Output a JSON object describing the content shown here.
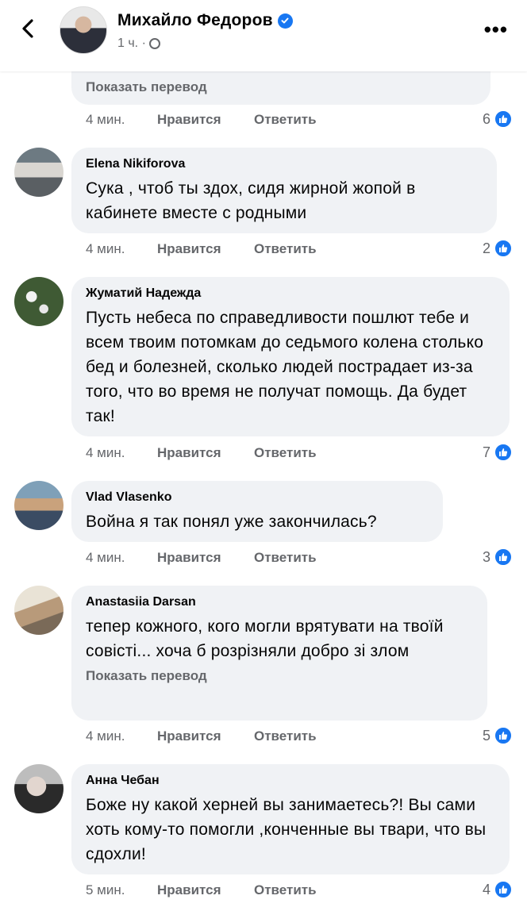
{
  "header": {
    "name": "Михайло Федоров",
    "time": "1 ч. ·"
  },
  "prev": {
    "translate": "Показать перевод",
    "time": "4 мин.",
    "like": "Нравится",
    "reply": "Ответить",
    "count": "6"
  },
  "comments": [
    {
      "author": "Elena Nikiforova",
      "text": "Сука , чтоб ты здох, сидя жирной жопой в кабинете  вместе с родными",
      "time": "4 мин.",
      "like": "Нравится",
      "reply": "Ответить",
      "count": "2"
    },
    {
      "author": "Жуматий Надежда",
      "text": "Пусть небеса по справедливости пошлют тебе и всем твоим потомкам до седьмого колена столько бед и болезней, сколько людей пострадает из-за того, что во время не получат помощь. Да будет так!",
      "time": "4 мин.",
      "like": "Нравится",
      "reply": "Ответить",
      "count": "7"
    },
    {
      "author": "Vlad Vlasenko",
      "text": "Война я так понял уже закончилась?",
      "time": "4 мин.",
      "like": "Нравится",
      "reply": "Ответить",
      "count": "3"
    },
    {
      "author": "Anastasiia Darsan",
      "text": "тепер кожного, кого могли врятувати на твоїй совісті... хоча б розрізняли добро зі злом",
      "translate": "Показать перевод",
      "time": "4 мин.",
      "like": "Нравится",
      "reply": "Ответить",
      "count": "5"
    },
    {
      "author": "Анна Чебан",
      "text": "Боже ну какой херней вы занимаетесь?! Вы сами хоть кому-то помогли ,конченные вы твари, что вы сдохли!",
      "time": "5 мин.",
      "like": "Нравится",
      "reply": "Ответить",
      "count": "4"
    }
  ],
  "colors": {
    "bubble": "#f0f2f5",
    "meta": "#65676b",
    "accent": "#1877f2"
  },
  "icons": [
    "back-icon",
    "verified-icon",
    "globe-icon",
    "more-icon",
    "like-reaction-icon"
  ]
}
